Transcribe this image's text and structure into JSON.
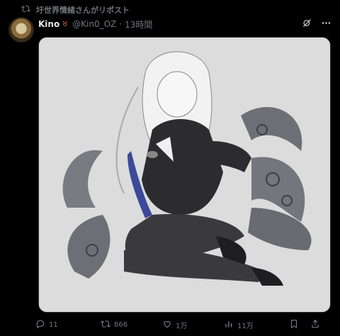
{
  "repost": {
    "text": "圩世界情緒さんがリポスト"
  },
  "author": {
    "name": "Kino",
    "badge": "♉",
    "handle": "@Kin0_OZ",
    "time": "13時間"
  },
  "media": {
    "description_icon": "illustration"
  },
  "actions": {
    "replies": "11",
    "reposts": "866",
    "likes": "1万",
    "views": "11万"
  },
  "colors": {
    "background": "#000000",
    "text": "#e7e9ea",
    "muted": "#71767b",
    "media_bg": "#dcdcdc"
  }
}
